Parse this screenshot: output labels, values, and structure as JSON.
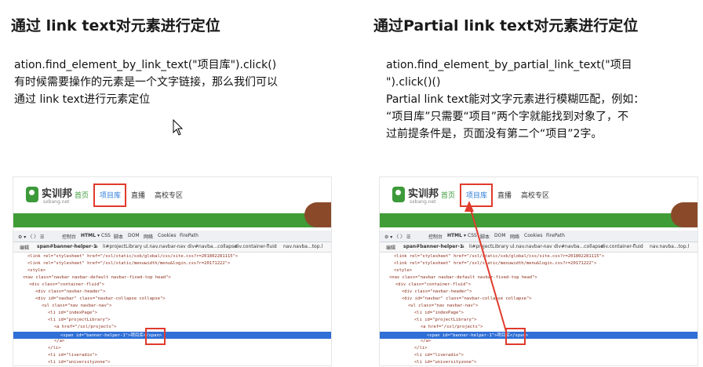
{
  "left": {
    "title": "通过 link text对元素进行定位",
    "code_line": "ation.find_element_by_link_text(\"项目库\").click()",
    "desc_1": "有时候需要操作的元素是一个文字链接，那么我们可以",
    "desc_2": "通过 link text进行元素定位"
  },
  "right": {
    "title": "通过Partial link text对元素进行定位",
    "code_line_1": "ation.find_element_by_partial_link_text(\"项目",
    "code_line_2": "\").click()()",
    "desc_1": "Partial link text能对文字元素进行模糊匹配，例如：",
    "desc_2": "“项目库”只需要“项目”两个字就能找到对象了，不",
    "desc_3": "过前提条件是，页面没有第二个“项目”2字。"
  },
  "screenshot": {
    "logo": "实训邦",
    "logo_sub": "sxbang.net",
    "nav_home": "首页",
    "nav_project": "项目库",
    "nav_live": "直播",
    "nav_campus": "高校专区",
    "devtools_tabs": [
      "控制台",
      "HTML ▾",
      "CSS",
      "脚本",
      "DOM",
      "网络",
      "Cookies",
      "FirePath"
    ],
    "breadcrumb": [
      "编辑",
      "span#banner-helper-1",
      "a",
      "li#projectLibrary",
      "ul.nav.navbar-nav",
      "div#navba...collapse",
      "div.container-fluid",
      "nav.navba...top.l"
    ],
    "code_lines": [
      "<link rel=\"stylesheet\" href=\"/sxl/static/sxb/global/css/site.css?r=201802281115\">",
      "<link rel=\"stylesheet\" href=\"/sxl/static/menuwidth/menu&login.css?r=20171222\">",
      "<style>",
      "<nav class=\"navbar navbar-default navbar-fixed-top head\">",
      "<div class=\"container-fluid\">",
      "<div class=\"navbar-header\">",
      "<div id=\"navbar\" class=\"navbar-collapse collapse\">",
      "<ul class=\"nav navbar-nav\">",
      "<li id=\"indexPage\">",
      "<li id=\"projectLibrary\">",
      "<a href=\"/sxl/projects\">",
      "<span id=\"banner-helper-1\">项目库</span>",
      "</a>",
      "</li>",
      "<li id=\"liveradio\">",
      "<li id=\"universityzone\">"
    ]
  }
}
